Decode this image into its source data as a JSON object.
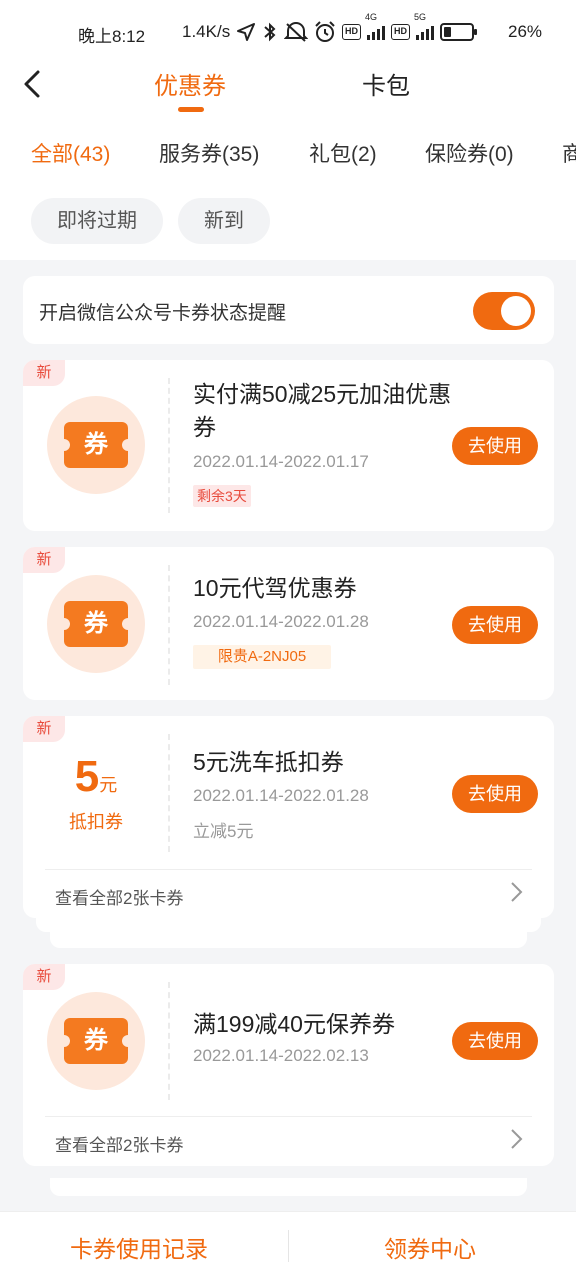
{
  "status_bar": {
    "time": "晚上8:12",
    "net_speed": "1.4K/s",
    "battery_pct": "26%",
    "icons": [
      "location-icon",
      "bluetooth-icon",
      "mute-icon",
      "alarm-icon",
      "hd-icon",
      "signal-4g-icon",
      "hd-icon",
      "signal-5g-icon",
      "battery-icon"
    ],
    "network_4g": "4G",
    "network_5g": "5G",
    "hd": "HD"
  },
  "header": {
    "tabs": [
      "优惠券",
      "卡包"
    ],
    "active_tab": "优惠券",
    "accent_color": "#f06a10"
  },
  "filter_tabs": [
    "全部(43)",
    "服务券(35)",
    "礼包(2)",
    "保险券(0)",
    "商"
  ],
  "chips": [
    "即将过期",
    "新到"
  ],
  "reminder": {
    "label": "开启微信公众号卡券状态提醒",
    "enabled": true
  },
  "coupons": [
    {
      "new_tag": "新",
      "icon_text": "券",
      "title": "实付满50减25元加油优惠券",
      "date": "2022.01.14-2022.01.17",
      "tag": "剩余3天",
      "button": "去使用"
    },
    {
      "new_tag": "新",
      "icon_text": "券",
      "title": "10元代驾优惠券",
      "date": "2022.01.14-2022.01.28",
      "tag": "限贵A-2NJ05",
      "button": "去使用"
    },
    {
      "new_tag": "新",
      "amount": "5",
      "amount_unit": "元",
      "amount_label": "抵扣券",
      "title": "5元洗车抵扣券",
      "date": "2022.01.14-2022.01.28",
      "note": "立减5元",
      "button": "去使用",
      "view_all": "查看全部2张卡券"
    },
    {
      "new_tag": "新",
      "icon_text": "券",
      "title": "满199减40元保养券",
      "date": "2022.01.14-2022.02.13",
      "button": "去使用",
      "view_all": "查看全部2张卡券"
    }
  ],
  "bottom_bar": {
    "left": "卡券使用记录",
    "right": "领券中心"
  }
}
